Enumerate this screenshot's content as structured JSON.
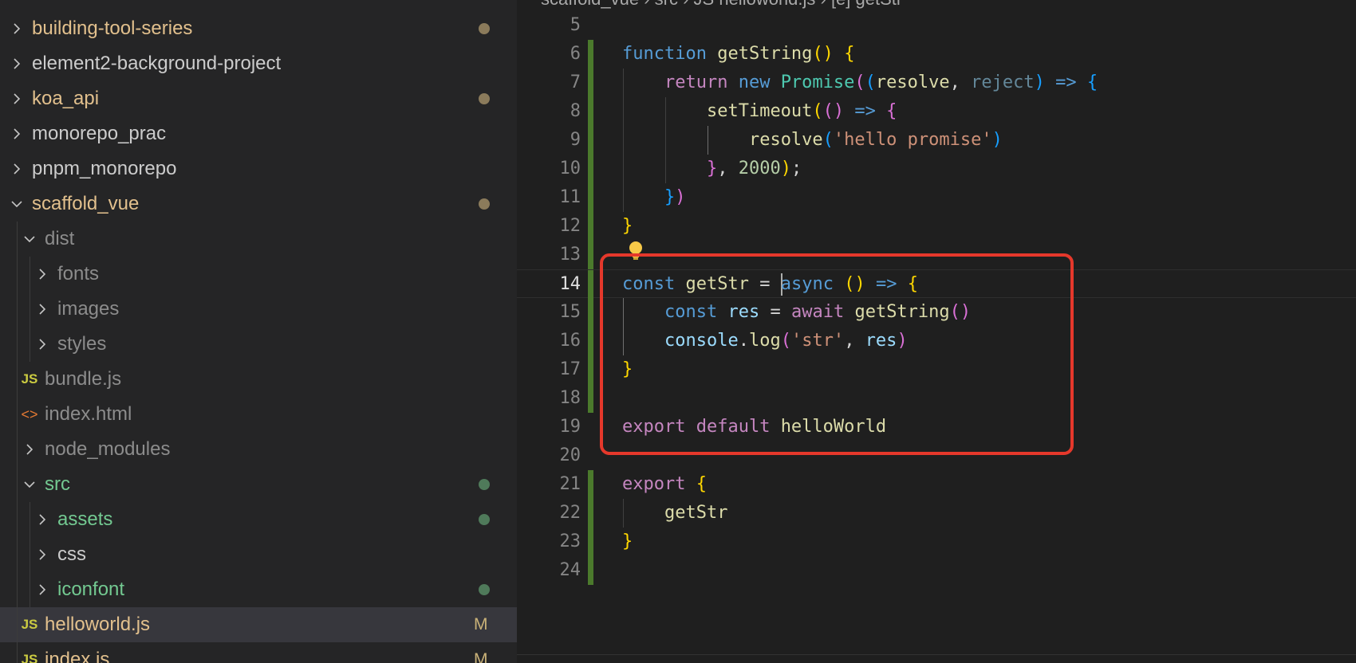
{
  "explorer": {
    "items": [
      {
        "label": "building-tool-series",
        "type": "folder",
        "expanded": false,
        "indent": 0,
        "color": "gold",
        "decoration": "dot-gold"
      },
      {
        "label": "element2-background-project",
        "type": "folder",
        "expanded": false,
        "indent": 0,
        "color": "white",
        "decoration": ""
      },
      {
        "label": "koa_api",
        "type": "folder",
        "expanded": false,
        "indent": 0,
        "color": "gold",
        "decoration": "dot-gold"
      },
      {
        "label": "monorepo_prac",
        "type": "folder",
        "expanded": false,
        "indent": 0,
        "color": "white",
        "decoration": ""
      },
      {
        "label": "pnpm_monorepo",
        "type": "folder",
        "expanded": false,
        "indent": 0,
        "color": "white",
        "decoration": ""
      },
      {
        "label": "scaffold_vue",
        "type": "folder",
        "expanded": true,
        "indent": 0,
        "color": "gold",
        "decoration": "dot-gold"
      },
      {
        "label": "dist",
        "type": "folder",
        "expanded": true,
        "indent": 1,
        "color": "gray",
        "decoration": ""
      },
      {
        "label": "fonts",
        "type": "folder",
        "expanded": false,
        "indent": 2,
        "color": "gray",
        "decoration": ""
      },
      {
        "label": "images",
        "type": "folder",
        "expanded": false,
        "indent": 2,
        "color": "gray",
        "decoration": ""
      },
      {
        "label": "styles",
        "type": "folder",
        "expanded": false,
        "indent": 2,
        "color": "gray",
        "decoration": ""
      },
      {
        "label": "bundle.js",
        "type": "js",
        "indent": 1,
        "color": "gray",
        "decoration": ""
      },
      {
        "label": "index.html",
        "type": "html",
        "indent": 1,
        "color": "gray",
        "decoration": ""
      },
      {
        "label": "node_modules",
        "type": "folder",
        "expanded": false,
        "indent": 1,
        "color": "gray",
        "decoration": ""
      },
      {
        "label": "src",
        "type": "folder",
        "expanded": true,
        "indent": 1,
        "color": "green",
        "decoration": "dot-green"
      },
      {
        "label": "assets",
        "type": "folder",
        "expanded": false,
        "indent": 2,
        "color": "green",
        "decoration": "dot-green"
      },
      {
        "label": "css",
        "type": "folder",
        "expanded": false,
        "indent": 2,
        "color": "white",
        "decoration": ""
      },
      {
        "label": "iconfont",
        "type": "folder",
        "expanded": false,
        "indent": 2,
        "color": "green",
        "decoration": "dot-green"
      },
      {
        "label": "helloworld.js",
        "type": "js",
        "indent": 1,
        "color": "gold",
        "decoration": "M",
        "selected": true
      },
      {
        "label": "index.js",
        "type": "js",
        "indent": 1,
        "color": "gold",
        "decoration": "M"
      }
    ]
  },
  "editor": {
    "breadcrumb": "scaffold_vue › src › JS helloworld.js › [e] getStr",
    "lines": [
      {
        "n": "5",
        "tokens": []
      },
      {
        "n": "6",
        "tokens": [
          [
            "function ",
            "kw-blue"
          ],
          [
            "getString",
            "fn"
          ],
          [
            "()",
            "br1"
          ],
          [
            " ",
            "punc"
          ],
          [
            "{",
            "br1"
          ]
        ]
      },
      {
        "n": "7",
        "tokens": [
          [
            "    ",
            "punc"
          ],
          [
            "return ",
            "kw-pink"
          ],
          [
            "new ",
            "kw-blue"
          ],
          [
            "Promise",
            "type"
          ],
          [
            "(",
            "br2"
          ],
          [
            "(",
            "br3"
          ],
          [
            "resolve",
            "fn"
          ],
          [
            ", ",
            "punc"
          ],
          [
            "reject",
            "dim"
          ],
          [
            ")",
            "br3"
          ],
          [
            " => ",
            "kw-blue"
          ],
          [
            "{",
            "br3"
          ]
        ]
      },
      {
        "n": "8",
        "tokens": [
          [
            "        ",
            "punc"
          ],
          [
            "setTimeout",
            "fn"
          ],
          [
            "(",
            "br1"
          ],
          [
            "()",
            "br2"
          ],
          [
            " => ",
            "kw-blue"
          ],
          [
            "{",
            "br2"
          ]
        ]
      },
      {
        "n": "9",
        "tokens": [
          [
            "            ",
            "punc"
          ],
          [
            "resolve",
            "fn"
          ],
          [
            "(",
            "br3"
          ],
          [
            "'hello promise'",
            "str"
          ],
          [
            ")",
            "br3"
          ]
        ]
      },
      {
        "n": "10",
        "tokens": [
          [
            "        ",
            "punc"
          ],
          [
            "}",
            "br2"
          ],
          [
            ", ",
            "punc"
          ],
          [
            "2000",
            "num"
          ],
          [
            ")",
            "br1"
          ],
          [
            ";",
            "punc"
          ]
        ]
      },
      {
        "n": "11",
        "tokens": [
          [
            "    ",
            "punc"
          ],
          [
            "}",
            "br3"
          ],
          [
            ")",
            "br2"
          ]
        ]
      },
      {
        "n": "12",
        "tokens": [
          [
            "}",
            "br1"
          ]
        ]
      },
      {
        "n": "13",
        "tokens": []
      },
      {
        "n": "14",
        "tokens": [
          [
            "const ",
            "kw-blue"
          ],
          [
            "getStr",
            "fn"
          ],
          [
            " = ",
            "punc"
          ],
          [
            "|",
            "cursor"
          ],
          [
            "async ",
            "kw-blue"
          ],
          [
            "()",
            "br1"
          ],
          [
            " => ",
            "kw-blue"
          ],
          [
            "{",
            "br1"
          ]
        ]
      },
      {
        "n": "15",
        "tokens": [
          [
            "    ",
            "punc"
          ],
          [
            "const ",
            "kw-blue"
          ],
          [
            "res",
            "var"
          ],
          [
            " = ",
            "punc"
          ],
          [
            "await ",
            "kw-pink"
          ],
          [
            "getString",
            "fn"
          ],
          [
            "()",
            "br2"
          ]
        ]
      },
      {
        "n": "16",
        "tokens": [
          [
            "    ",
            "punc"
          ],
          [
            "console",
            "var"
          ],
          [
            ".",
            "punc"
          ],
          [
            "log",
            "fn"
          ],
          [
            "(",
            "br2"
          ],
          [
            "'str'",
            "str"
          ],
          [
            ", ",
            "punc"
          ],
          [
            "res",
            "var"
          ],
          [
            ")",
            "br2"
          ]
        ]
      },
      {
        "n": "17",
        "tokens": [
          [
            "}",
            "br1"
          ]
        ]
      },
      {
        "n": "18",
        "tokens": []
      },
      {
        "n": "19",
        "tokens": [
          [
            "export ",
            "kw-pink"
          ],
          [
            "default ",
            "kw-pink"
          ],
          [
            "helloWorld",
            "fn"
          ]
        ]
      },
      {
        "n": "20",
        "tokens": []
      },
      {
        "n": "21",
        "tokens": [
          [
            "export ",
            "kw-pink"
          ],
          [
            "{",
            "br1"
          ]
        ]
      },
      {
        "n": "22",
        "tokens": [
          [
            "    ",
            "punc"
          ],
          [
            "getStr",
            "fn"
          ]
        ]
      },
      {
        "n": "23",
        "tokens": [
          [
            "}",
            "br1"
          ]
        ]
      },
      {
        "n": "24",
        "tokens": []
      }
    ],
    "active_line": "14"
  },
  "colors": {
    "accent_highlight_box": "#e5382b",
    "git_added_gutter": "#4b7a2c",
    "lightbulb": "#f7c948"
  },
  "icons": {
    "collapsed_folder": "chevron-right-icon",
    "expanded_folder": "chevron-down-icon",
    "js_file": "js-file-icon",
    "html_file": "html-file-icon",
    "quick_fix": "lightbulb-icon"
  }
}
